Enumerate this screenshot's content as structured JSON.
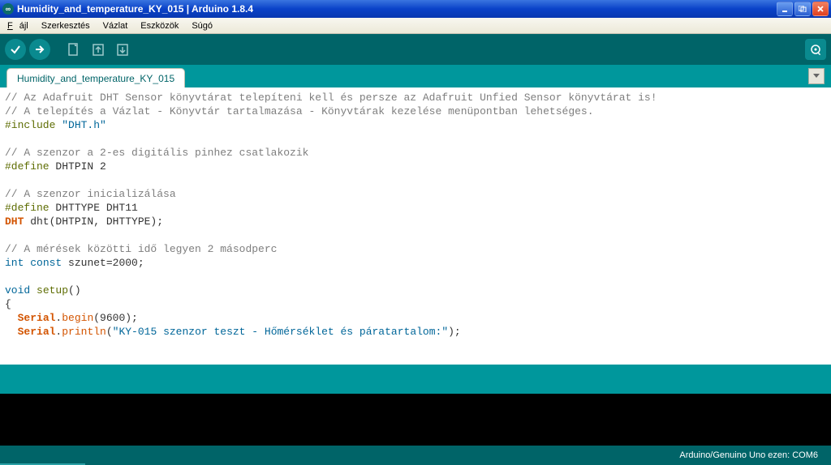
{
  "titlebar": {
    "title": "Humidity_and_temperature_KY_015 | Arduino 1.8.4"
  },
  "menu": {
    "file": "Fájl",
    "edit": "Szerkesztés",
    "sketch": "Vázlat",
    "tools": "Eszközök",
    "help": "Súgó"
  },
  "tab": {
    "name": "Humidity_and_temperature_KY_015"
  },
  "code": {
    "l1": "// Az Adafruit DHT Sensor könyvtárat telepíteni kell és persze az Adafruit Unfied Sensor könyvtárat is!",
    "l2": "// A telepítés a Vázlat - Könyvtár tartalmazása - Könyvtárak kezelése menüpontban lehetséges.",
    "l3a": "#include",
    "l3b": " \"DHT.h\"",
    "l5": "// A szenzor a 2-es digitális pinhez csatlakozik",
    "l6a": "#define",
    "l6b": " DHTPIN 2",
    "l8": "// A szenzor inicializálása",
    "l9a": "#define",
    "l9b": " DHTTYPE DHT11",
    "l10a": "DHT",
    "l10b": " dht(DHTPIN, DHTTYPE);",
    "l12": "// A mérések közötti idő legyen 2 másodperc",
    "l13a": "int",
    "l13b": " ",
    "l13c": "const",
    "l13d": " szunet=2000;",
    "l15a": "void",
    "l15b": " ",
    "l15c": "setup",
    "l15d": "()",
    "l16": "{",
    "l17a": "  ",
    "l17b": "Serial",
    "l17c": ".",
    "l17d": "begin",
    "l17e": "(9600);",
    "l18a": "  ",
    "l18b": "Serial",
    "l18c": ".",
    "l18d": "println",
    "l18e": "(",
    "l18f": "\"KY-015 szenzor teszt - Hőmérséklet és páratartalom:\"",
    "l18g": ");"
  },
  "status": {
    "board": "Arduino/Genuino Uno ezen: COM6"
  }
}
